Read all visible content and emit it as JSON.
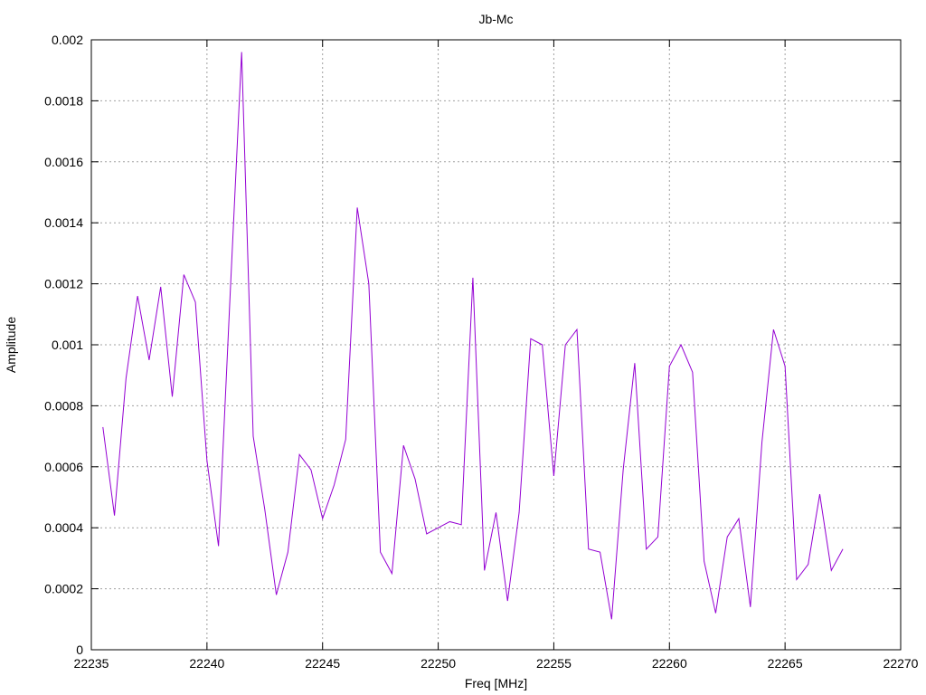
{
  "chart_data": {
    "type": "line",
    "title": "Jb-Mc",
    "xlabel": "Freq [MHz]",
    "ylabel": "Amplitude",
    "xlim": [
      22235,
      22270
    ],
    "ylim": [
      0,
      0.002
    ],
    "xticks": [
      22235,
      22240,
      22245,
      22250,
      22255,
      22260,
      22265,
      22270
    ],
    "yticks": [
      0,
      0.0002,
      0.0004,
      0.0006,
      0.0008,
      0.001,
      0.0012,
      0.0014,
      0.0016,
      0.0018,
      0.002
    ],
    "xtick_labels": [
      "22235",
      "22240",
      "22245",
      "22250",
      "22255",
      "22260",
      "22265",
      "22270"
    ],
    "ytick_labels": [
      "0",
      "0.0002",
      "0.0004",
      "0.0006",
      "0.0008",
      "0.001",
      "0.0012",
      "0.0014",
      "0.0016",
      "0.0018",
      "0.002"
    ],
    "grid": true,
    "series": [
      {
        "color": "#9400d3",
        "x": [
          22235.5,
          22236.0,
          22236.5,
          22237.0,
          22237.5,
          22238.0,
          22238.5,
          22239.0,
          22239.5,
          22240.0,
          22240.5,
          22241.0,
          22241.5,
          22242.0,
          22242.5,
          22243.0,
          22243.5,
          22244.0,
          22244.5,
          22245.0,
          22245.5,
          22246.0,
          22246.5,
          22247.0,
          22247.5,
          22248.0,
          22248.5,
          22249.0,
          22249.5,
          22250.0,
          22250.5,
          22251.0,
          22251.5,
          22252.0,
          22252.5,
          22253.0,
          22253.5,
          22254.0,
          22254.5,
          22255.0,
          22255.5,
          22256.0,
          22256.5,
          22257.0,
          22257.5,
          22258.0,
          22258.5,
          22259.0,
          22259.5,
          22260.0,
          22260.5,
          22261.0,
          22261.5,
          22262.0,
          22262.5,
          22263.0,
          22263.5,
          22264.0,
          22264.5,
          22265.0,
          22265.5,
          22266.0,
          22266.5,
          22267.0,
          22267.5
        ],
        "y": [
          0.00073,
          0.00044,
          0.00089,
          0.00116,
          0.00095,
          0.00119,
          0.00083,
          0.00123,
          0.00114,
          0.00062,
          0.00034,
          0.00116,
          0.00196,
          0.0007,
          0.00046,
          0.00018,
          0.00032,
          0.00064,
          0.00059,
          0.00043,
          0.00054,
          0.00069,
          0.00145,
          0.0012,
          0.00032,
          0.00025,
          0.00067,
          0.00056,
          0.00038,
          0.0004,
          0.00042,
          0.00041,
          0.00122,
          0.00026,
          0.00045,
          0.00016,
          0.00045,
          0.00102,
          0.001,
          0.00057,
          0.001,
          0.00105,
          0.00033,
          0.00032,
          0.0001,
          0.00059,
          0.00094,
          0.00033,
          0.00037,
          0.00093,
          0.001,
          0.00091,
          0.00029,
          0.00012,
          0.00037,
          0.00043,
          0.00014,
          0.00068,
          0.00105,
          0.00093,
          0.00023,
          0.00028,
          0.00051,
          0.00026,
          0.00033
        ]
      }
    ]
  }
}
